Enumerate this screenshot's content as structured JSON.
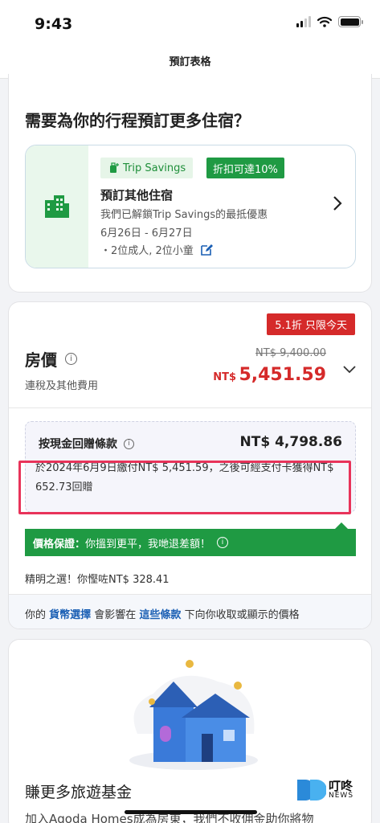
{
  "status_bar": {
    "time": "9:43"
  },
  "nav": {
    "title": "預訂表格"
  },
  "more_stays": {
    "heading": "需要為你的行程預訂更多住宿？",
    "savings_pill": "Trip Savings",
    "discount_pill": "折扣可達10%",
    "title": "預訂其他住宿",
    "subtitle": "我們已解鎖Trip Savings的最抵優惠",
    "dates": "6月26日 - 6月27日",
    "guests": "・2位成人, 2位小童"
  },
  "price": {
    "promo_badge": "5.1折 只限今天",
    "title": "房價",
    "subtitle": "連稅及其他費用",
    "original_price": "NT$ 9,400.00",
    "currency_label": "NT$",
    "current_price": "5,451.59",
    "cashback": {
      "title": "按現金回贈條款",
      "amount": "NT$ 4,798.86",
      "text": "於2024年6月9日繳付NT$ 5,451.59，之後可經支付卡獲得NT$ 652.73回贈"
    },
    "guarantee": {
      "label": "價格保證：",
      "text": "你搵到更平，我哋退差額！"
    },
    "savings_line": "精明之選！你慳咗NT$ 328.41",
    "footer": {
      "prefix": "你的 ",
      "currency_link": "貨幣選擇",
      "middle": " 會影響在 ",
      "terms_link": "這些條款",
      "suffix": " 下向你收取或顯示的價格"
    }
  },
  "earn": {
    "heading": "賺更多旅遊基金",
    "text": "加入Agoda Homes成為房東，我們不收佣金助你將物"
  },
  "watermark": {
    "cn": "叮咚",
    "en": "NEWS"
  },
  "colors": {
    "green": "#1f9a43",
    "red": "#d52a2a",
    "link": "#1a5fb4",
    "highlight": "#e8335a"
  }
}
